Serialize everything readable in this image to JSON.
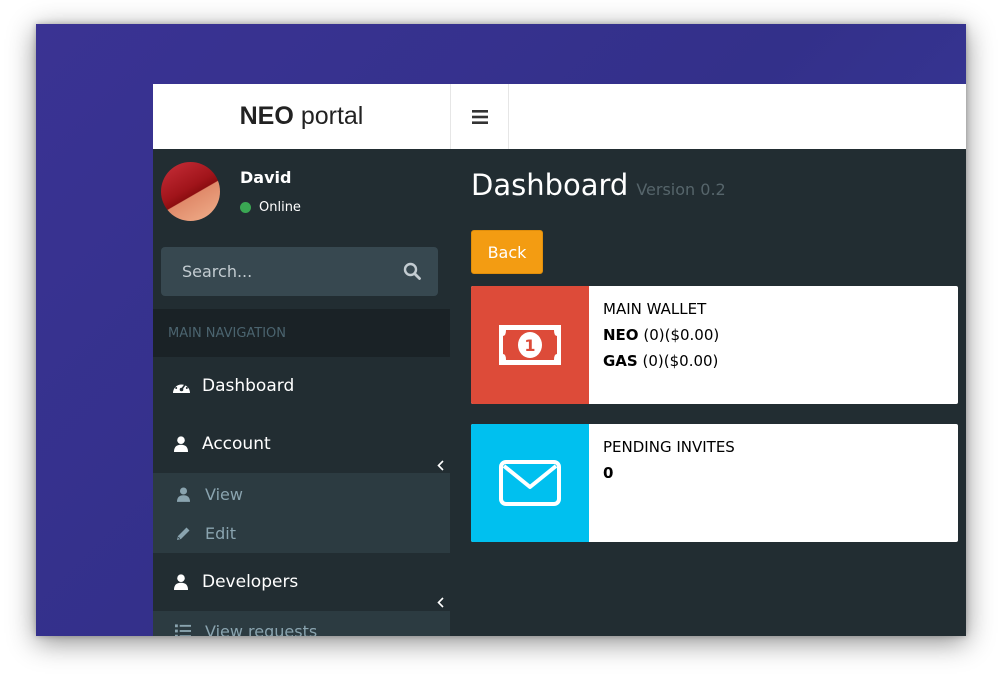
{
  "header": {
    "logo_bold": "NEO",
    "logo_light": "portal"
  },
  "sidebar": {
    "user": {
      "name": "David",
      "status": "Online"
    },
    "search": {
      "placeholder": "Search..."
    },
    "nav_header": "MAIN NAVIGATION",
    "items": [
      {
        "label": "Dashboard",
        "icon": "dashboard-icon"
      },
      {
        "label": "Account",
        "icon": "user-icon",
        "submenu": [
          {
            "label": "View",
            "icon": "user-icon"
          },
          {
            "label": "Edit",
            "icon": "pencil-icon"
          }
        ]
      },
      {
        "label": "Developers",
        "icon": "user-icon",
        "submenu": [
          {
            "label": "View requests",
            "icon": "list-icon"
          }
        ]
      }
    ]
  },
  "main": {
    "title": "Dashboard",
    "version": "Version 0.2",
    "back_label": "Back",
    "wallet": {
      "label": "MAIN WALLET",
      "neo_name": "NEO",
      "neo_value": "(0)($0.00)",
      "gas_name": "GAS",
      "gas_value": "(0)($0.00)",
      "icon": "money-icon",
      "color": "#dd4b39"
    },
    "invites": {
      "label": "PENDING INVITES",
      "count": "0",
      "icon": "envelope-icon",
      "color": "#00c0ef"
    }
  },
  "colors": {
    "background": "#3a3393",
    "sidebar": "#222d32",
    "back_button": "#f39c12",
    "status_online": "#3aa753"
  }
}
